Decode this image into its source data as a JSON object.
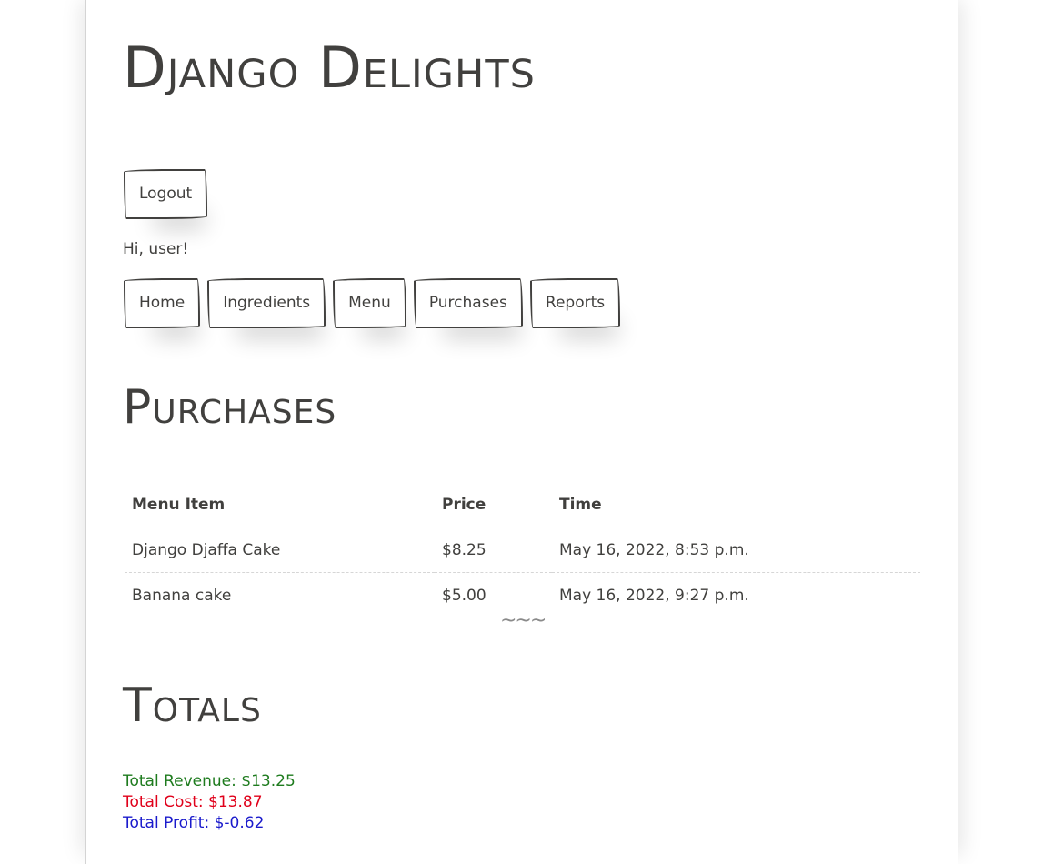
{
  "site": {
    "title": "Django Delights"
  },
  "auth": {
    "logout_label": "Logout",
    "greeting": "Hi, user!"
  },
  "nav": {
    "items": [
      {
        "label": "Home"
      },
      {
        "label": "Ingredients"
      },
      {
        "label": "Menu"
      },
      {
        "label": "Purchases"
      },
      {
        "label": "Reports"
      }
    ]
  },
  "purchases": {
    "title": "Purchases",
    "columns": [
      "Menu Item",
      "Price",
      "Time"
    ],
    "rows": [
      {
        "item": "Django Djaffa Cake",
        "price": "$8.25",
        "time": "May 16, 2022, 8:53 p.m."
      },
      {
        "item": "Banana cake",
        "price": "$5.00",
        "time": "May 16, 2022, 9:27 p.m."
      }
    ],
    "divider": "~~~"
  },
  "totals": {
    "title": "Totals",
    "revenue": "Total Revenue: $13.25",
    "cost": "Total Cost: $13.87",
    "profit": "Total Profit: $-0.62"
  },
  "colors": {
    "text": "#41403e",
    "revenue": "#1e7b1e",
    "cost": "#e0001a",
    "profit": "#1a1acc"
  }
}
